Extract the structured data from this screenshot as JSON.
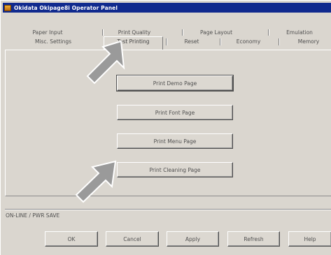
{
  "window": {
    "title": "Okidata Okipage8i Operator Panel"
  },
  "tabs": {
    "row_back": [
      "Paper Input",
      "Print Quality",
      "Page Layout",
      "Emulation"
    ],
    "row_front": [
      "Misc. Settings",
      "Test Printing",
      "Reset",
      "Economy",
      "Memory"
    ],
    "active": "Test Printing"
  },
  "panel_buttons": [
    "Print Demo Page",
    "Print Font Page",
    "Print Menu Page",
    "Print Cleaning Page"
  ],
  "status": "ON-LINE / PWR SAVE",
  "dialog_buttons": [
    "OK",
    "Cancel",
    "Apply",
    "Refresh",
    "Help"
  ],
  "colors": {
    "titlebar": "#102a8e",
    "face": "#dad6cf",
    "arrow": "#9a9a9a"
  },
  "icons": {
    "callout_arrow": "arrow-icon",
    "app": "printer-app-icon"
  }
}
